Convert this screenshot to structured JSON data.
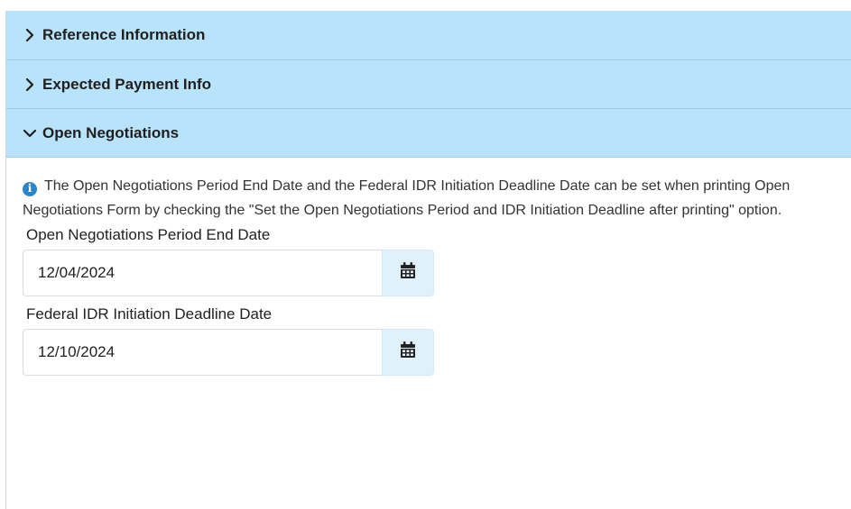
{
  "accordion": {
    "sections": [
      {
        "title": "Reference Information",
        "expanded": false,
        "icon": "chevron-right-icon"
      },
      {
        "title": "Expected Payment Info",
        "expanded": false,
        "icon": "chevron-right-icon"
      },
      {
        "title": "Open Negotiations",
        "expanded": true,
        "icon": "chevron-down-icon"
      }
    ]
  },
  "open_negotiations": {
    "info_icon": "info-circle-icon",
    "info_text": "The Open Negotiations Period End Date and the Federal IDR Initiation Deadline Date can be set when printing Open Negotiations Form by checking the \"Set the Open Negotiations Period and IDR Initiation Deadline after printing\" option.",
    "fields": [
      {
        "label": "Open Negotiations Period End Date",
        "value": "12/04/2024",
        "icon": "calendar-icon"
      },
      {
        "label": "Federal IDR Initiation Deadline Date",
        "value": "12/10/2024",
        "icon": "calendar-icon"
      }
    ]
  },
  "colors": {
    "header_bg": "#b9e3fb",
    "calendar_button_bg": "#e1f1fc",
    "info_icon": "#2a86c9"
  }
}
